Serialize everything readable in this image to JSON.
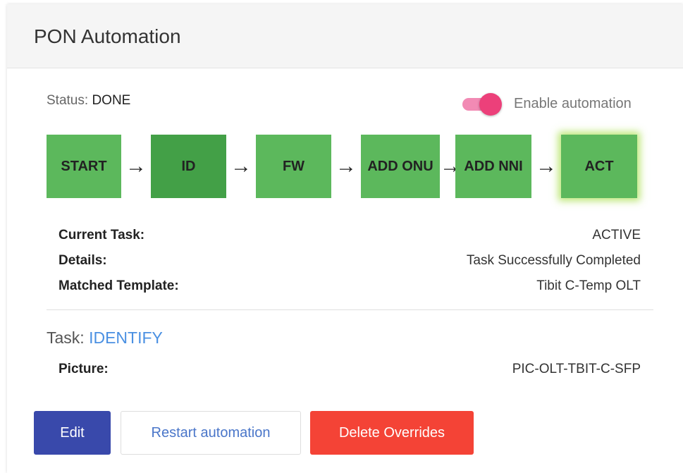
{
  "card": {
    "title": "PON Automation"
  },
  "status": {
    "label": "Status:",
    "value": "DONE"
  },
  "toggle": {
    "label": "Enable automation",
    "checked": true,
    "color": "#ec407a"
  },
  "steps": [
    {
      "label": "START",
      "state": "done"
    },
    {
      "label": "ID",
      "state": "current"
    },
    {
      "label": "FW",
      "state": "done"
    },
    {
      "label": "ADD ONU",
      "state": "done"
    },
    {
      "label": "ADD NNI",
      "state": "done"
    },
    {
      "label": "ACT",
      "state": "done-highlighted"
    }
  ],
  "arrow_glyph": "→",
  "info": {
    "current_task": {
      "label": "Current Task:",
      "value": "ACTIVE"
    },
    "details": {
      "label": "Details:",
      "value": "Task Successfully Completed"
    },
    "matched_template": {
      "label": "Matched Template:",
      "value": "Tibit C-Temp OLT"
    }
  },
  "task": {
    "label": "Task:",
    "name": "IDENTIFY",
    "picture": {
      "label": "Picture:",
      "value": "PIC-OLT-TBIT-C-SFP"
    }
  },
  "buttons": {
    "edit": "Edit",
    "restart": "Restart automation",
    "delete": "Delete Overrides"
  },
  "colors": {
    "step_green": "#5cb85c",
    "step_current": "#43a047",
    "edit_btn": "#3949ab",
    "delete_btn": "#f44336",
    "link_blue": "#4a90e2"
  }
}
